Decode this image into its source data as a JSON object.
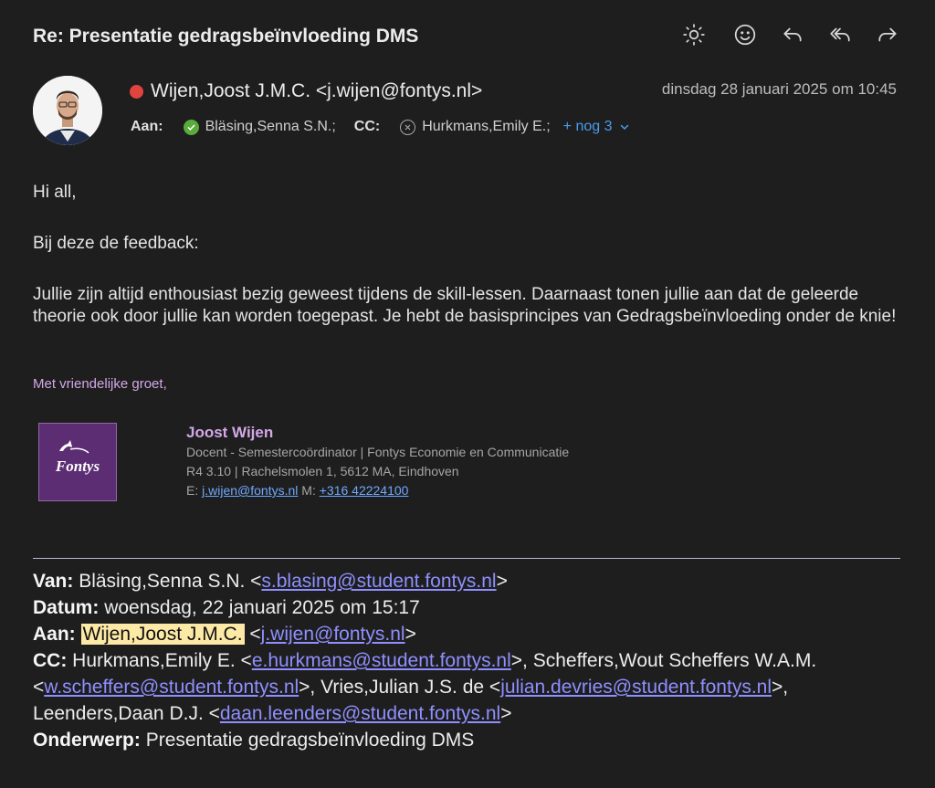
{
  "window": {
    "title": "Re: Presentatie gedragsbeïnvloeding DMS",
    "toolbar": [
      "sun-icon",
      "emoji-icon",
      "reply-icon",
      "reply-all-icon",
      "forward-icon"
    ]
  },
  "header": {
    "sender": "Wijen,Joost J.M.C. <j.wijen@fontys.nl>",
    "status_color": "#e0443e",
    "date": "dinsdag 28 januari 2025 om 10:45",
    "to_label": "Aan:",
    "to": "Bläsing,Senna S.N.;",
    "cc_label": "CC:",
    "cc": "Hurkmans,Emily E.;",
    "more": "+ nog 3"
  },
  "body": {
    "greeting": "Hi all,",
    "intro": "Bij deze de feedback:",
    "paragraph": "Jullie zijn altijd enthousiast bezig geweest tijdens de skill-lessen. Daarnaast tonen jullie aan dat de geleerde theorie ook door jullie kan worden toegepast. Je hebt de basisprincipes van Gedragsbeïnvloeding onder de knie!",
    "closing": "Met vriendelijke groet,"
  },
  "signature": {
    "logo_text": "Fontys",
    "name": "Joost Wijen",
    "role": "Docent - Semestercoördinator | Fontys Economie en Communicatie",
    "address": "R4 3.10 | Rachelsmolen 1, 5612 MA, Eindhoven",
    "email_label": "E:",
    "email": "j.wijen@fontys.nl",
    "phone_label": "M:",
    "phone": "+316 42224100"
  },
  "quoted": {
    "from_label": "Van:",
    "from_name": "Bläsing,Senna S.N. <",
    "from_email": "s.blasing@student.fontys.nl",
    "date_label": "Datum:",
    "date": "woensdag, 22 januari 2025 om 15:17",
    "to_label": "Aan:",
    "to_name": "Wijen,Joost J.M.C.",
    "to_email": "j.wijen@fontys.nl",
    "cc_label": "CC:",
    "cc1_name": "Hurkmans,Emily E. <",
    "cc1_email": "e.hurkmans@student.fontys.nl",
    "cc2_name": ">, Scheffers,Wout Scheffers W.A.M. <",
    "cc2_email": "w.scheffers@student.fontys.nl",
    "cc3_name": ">, Vries,Julian J.S. de <",
    "cc3_email": "julian.devries@student.fontys.nl",
    "cc4_name": ">, Leenders,Daan D.J. <",
    "cc4_email": "daan.leenders@student.fontys.nl",
    "subject_label": "Onderwerp:",
    "subject": "Presentatie gedragsbeïnvloeding DMS"
  }
}
